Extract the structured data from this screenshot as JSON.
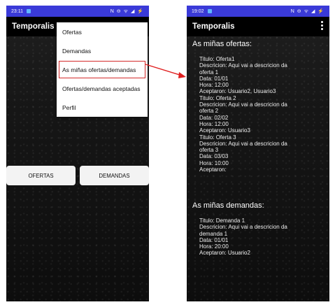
{
  "left_phone": {
    "status": {
      "time": "23:11",
      "icons": "N ⊖ ᯤ ◢ ⚡"
    },
    "app_title": "Temporalis",
    "menu_items": [
      "Ofertas",
      "Demandas",
      "As miñas ofertas/demandas",
      "Ofertas/demandas aceptadas",
      "Perfil"
    ],
    "buttons": {
      "ofertas": "OFERTAS",
      "demandas": "DEMANDAS"
    }
  },
  "right_phone": {
    "status": {
      "time": "19:02",
      "icons": "N ⊖ ᯤ ◢ ⚡"
    },
    "app_title": "Temporalis",
    "offers_heading": "As miñas ofertas:",
    "offers": [
      [
        "Titulo: Oferta1",
        "Descricion: Aqui vai a descricion da",
        "oferta 1",
        "Data: 01/01",
        "Hora: 12:00",
        "Aceptaron: Usuario2, Usuario3"
      ],
      [
        "Titulo: Oferta 2",
        "Descricion: Aqui vai a descricion da",
        "oferta 2",
        "Data: 02/02",
        "Hora: 12:00",
        "Aceptaron: Usuario3"
      ],
      [
        "Titulo: Oferta 3",
        "Descricion: Aqui vai a descricion da",
        "oferta 3",
        "Data: 03/03",
        "Hora: 10:00",
        "Aceptaron:"
      ]
    ],
    "demands_heading": "As miñas demandas:",
    "demands": [
      [
        "Titulo: Demanda 1",
        "Descricion: Aqui vai a descricion da",
        "demanda 1",
        "Data: 01/01",
        "Hora: 20:00",
        "Aceptaron: Usuario2"
      ]
    ]
  },
  "colors": {
    "status_bar": "#3a3ad8",
    "app_bar": "#000000",
    "highlight": "#d42a2a",
    "arrow": "#e02020"
  }
}
